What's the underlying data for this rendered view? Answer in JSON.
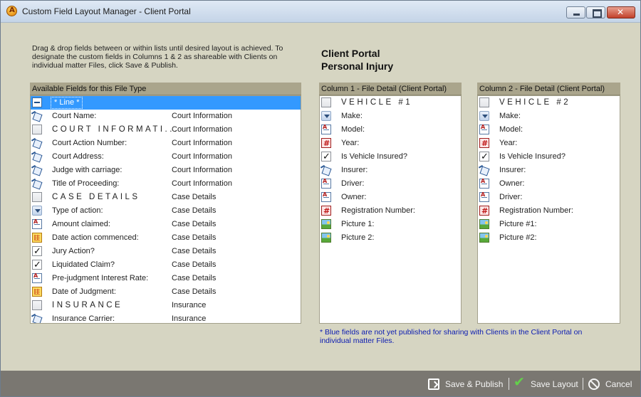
{
  "window": {
    "title": "Custom Field Layout Manager - Client Portal",
    "controls": {
      "minimize": "minimize",
      "maximize": "maximize",
      "close": "close"
    }
  },
  "instructions": "Drag & drop fields between or within lists until desired layout is achieved. To designate the custom fields in Columns 1 & 2 as shareable with Clients on individual matter Files, click Save & Publish.",
  "portal": {
    "line1": "Client Portal",
    "line2": "Personal Injury"
  },
  "available": {
    "header": "Available Fields for this File Type",
    "items": [
      {
        "icon": "line-icon",
        "label": "* Line *",
        "category": "",
        "selected": true,
        "style": "normal"
      },
      {
        "icon": "contact-icon",
        "label": "Court Name:",
        "category": "Court Information",
        "style": "normal"
      },
      {
        "icon": "checkbox-icon",
        "label": "COURT INFORMATI...",
        "category": "Court Information",
        "style": "spaced"
      },
      {
        "icon": "contact-icon",
        "label": "Court Action Number:",
        "category": "Court Information",
        "style": "normal"
      },
      {
        "icon": "contact-icon",
        "label": "Court Address:",
        "category": "Court Information",
        "style": "normal"
      },
      {
        "icon": "contact-icon",
        "label": "Judge with carriage:",
        "category": "Court Information",
        "style": "normal"
      },
      {
        "icon": "contact-icon",
        "label": "Title of Proceeding:",
        "category": "Court Information",
        "style": "normal"
      },
      {
        "icon": "checkbox-icon",
        "label": "CASE DETAILS",
        "category": "Case Details",
        "style": "spaced"
      },
      {
        "icon": "dropdown-icon",
        "label": "Type of action:",
        "category": "Case Details",
        "style": "normal"
      },
      {
        "icon": "text-icon",
        "label": "Amount claimed:",
        "category": "Case Details",
        "style": "normal"
      },
      {
        "icon": "date-icon",
        "label": "Date action commenced:",
        "category": "Case Details",
        "style": "normal"
      },
      {
        "icon": "checked-icon",
        "label": "Jury Action?",
        "category": "Case Details",
        "style": "normal"
      },
      {
        "icon": "checked-icon",
        "label": "Liquidated Claim?",
        "category": "Case Details",
        "style": "normal"
      },
      {
        "icon": "text-icon",
        "label": "Pre-judgment Interest Rate:",
        "category": "Case Details",
        "style": "normal"
      },
      {
        "icon": "date-icon",
        "label": "Date of Judgment:",
        "category": "Case Details",
        "style": "normal"
      },
      {
        "icon": "checkbox-icon",
        "label": "INSURANCE",
        "category": "Insurance",
        "style": "spaced"
      },
      {
        "icon": "contact-icon",
        "label": "Insurance Carrier:",
        "category": "Insurance",
        "style": "normal"
      }
    ]
  },
  "column1": {
    "header": "Column 1 - File Detail (Client Portal)",
    "items": [
      {
        "icon": "checkbox-icon",
        "label": "VEHICLE #1",
        "style": "spaced"
      },
      {
        "icon": "dropdown-icon",
        "label": "Make:",
        "style": "normal"
      },
      {
        "icon": "text-icon",
        "label": "Model:",
        "style": "normal"
      },
      {
        "icon": "number-icon",
        "label": "Year:",
        "style": "normal"
      },
      {
        "icon": "checked-icon",
        "label": "Is Vehicle Insured?",
        "style": "normal"
      },
      {
        "icon": "contact-icon",
        "label": "Insurer:",
        "style": "normal"
      },
      {
        "icon": "text-icon",
        "label": "Driver:",
        "style": "normal"
      },
      {
        "icon": "text-icon",
        "label": "Owner:",
        "style": "normal"
      },
      {
        "icon": "number-icon",
        "label": "Registration Number:",
        "style": "normal"
      },
      {
        "icon": "picture-icon",
        "label": "Picture 1:",
        "style": "normal"
      },
      {
        "icon": "picture-icon",
        "label": "Picture 2:",
        "style": "normal"
      }
    ]
  },
  "column2": {
    "header": "Column 2 - File Detail (Client Portal)",
    "items": [
      {
        "icon": "checkbox-icon",
        "label": "VEHICLE #2",
        "style": "spaced"
      },
      {
        "icon": "dropdown-icon",
        "label": "Make:",
        "style": "normal"
      },
      {
        "icon": "text-icon",
        "label": "Model:",
        "style": "normal"
      },
      {
        "icon": "number-icon",
        "label": "Year:",
        "style": "normal"
      },
      {
        "icon": "checked-icon",
        "label": "Is Vehicle Insured?",
        "style": "normal"
      },
      {
        "icon": "contact-icon",
        "label": "Insurer:",
        "style": "normal"
      },
      {
        "icon": "text-icon",
        "label": "Owner:",
        "style": "normal"
      },
      {
        "icon": "text-icon",
        "label": "Driver:",
        "style": "normal"
      },
      {
        "icon": "number-icon",
        "label": "Registration Number:",
        "style": "normal"
      },
      {
        "icon": "picture-icon",
        "label": "Picture #1:",
        "style": "normal"
      },
      {
        "icon": "picture-icon",
        "label": "Picture #2:",
        "style": "normal"
      }
    ]
  },
  "footnote": "* Blue fields are not yet published for sharing with Clients in the Client Portal on individual matter Files.",
  "footer": {
    "save_publish": "Save & Publish",
    "save_layout": "Save Layout",
    "cancel": "Cancel"
  },
  "colors": {
    "dialog_background": "#d6d5c2",
    "panel_header": "#aaa58c",
    "selection": "#3399ff",
    "footer_bar": "#7a7771",
    "footnote_text": "#0b1bb1"
  }
}
